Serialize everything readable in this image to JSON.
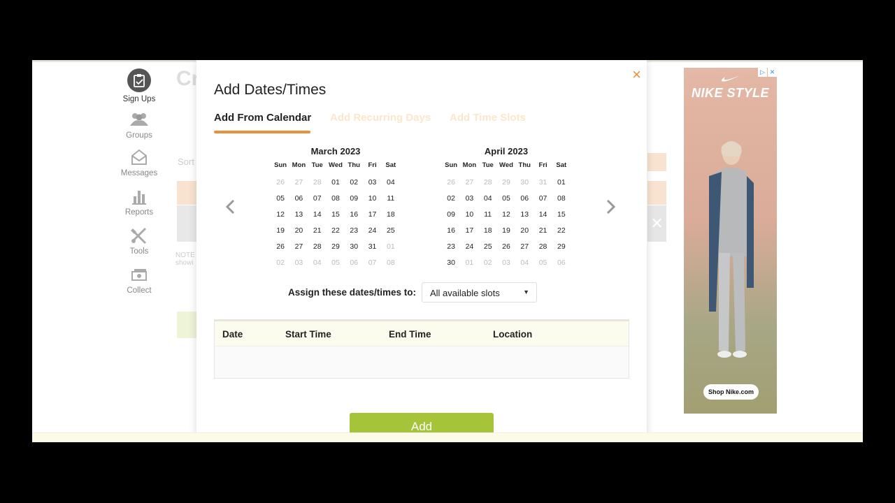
{
  "nav": {
    "items": [
      {
        "label": "Sign Ups",
        "icon": "clipboard-icon"
      },
      {
        "label": "Groups",
        "icon": "people-icon"
      },
      {
        "label": "Messages",
        "icon": "envelope-icon"
      },
      {
        "label": "Reports",
        "icon": "bar-chart-icon"
      },
      {
        "label": "Tools",
        "icon": "tools-icon"
      },
      {
        "label": "Collect",
        "icon": "money-icon"
      }
    ]
  },
  "background": {
    "title": "Cr",
    "sort_label": "Sort",
    "note": "NOTE",
    "note2": "showi"
  },
  "modal": {
    "title": "Add Dates/Times",
    "close": "×",
    "tabs": [
      {
        "label": "Add From Calendar",
        "active": true
      },
      {
        "label": "Add Recurring Days",
        "active": false
      },
      {
        "label": "Add Time Slots",
        "active": false
      }
    ],
    "prev": "‹",
    "next": "›",
    "weekdays": [
      "Sun",
      "Mon",
      "Tue",
      "Wed",
      "Thu",
      "Fri",
      "Sat"
    ],
    "calendars": [
      {
        "title": "March 2023",
        "weeks": [
          [
            [
              "26",
              1
            ],
            [
              "27",
              1
            ],
            [
              "28",
              1
            ],
            [
              "01",
              0
            ],
            [
              "02",
              0
            ],
            [
              "03",
              0
            ],
            [
              "04",
              0
            ]
          ],
          [
            [
              "05",
              0
            ],
            [
              "06",
              0
            ],
            [
              "07",
              0
            ],
            [
              "08",
              0
            ],
            [
              "09",
              0
            ],
            [
              "10",
              0
            ],
            [
              "11",
              0
            ]
          ],
          [
            [
              "12",
              0
            ],
            [
              "13",
              0
            ],
            [
              "14",
              0
            ],
            [
              "15",
              0
            ],
            [
              "16",
              0
            ],
            [
              "17",
              0
            ],
            [
              "18",
              0
            ]
          ],
          [
            [
              "19",
              0
            ],
            [
              "20",
              0
            ],
            [
              "21",
              0
            ],
            [
              "22",
              0
            ],
            [
              "23",
              0
            ],
            [
              "24",
              0
            ],
            [
              "25",
              0
            ]
          ],
          [
            [
              "26",
              0
            ],
            [
              "27",
              0
            ],
            [
              "28",
              0
            ],
            [
              "29",
              0
            ],
            [
              "30",
              0
            ],
            [
              "31",
              0
            ],
            [
              "01",
              1
            ]
          ],
          [
            [
              "02",
              1
            ],
            [
              "03",
              1
            ],
            [
              "04",
              1
            ],
            [
              "05",
              1
            ],
            [
              "06",
              1
            ],
            [
              "07",
              1
            ],
            [
              "08",
              1
            ]
          ]
        ]
      },
      {
        "title": "April 2023",
        "weeks": [
          [
            [
              "26",
              1
            ],
            [
              "27",
              1
            ],
            [
              "28",
              1
            ],
            [
              "29",
              1
            ],
            [
              "30",
              1
            ],
            [
              "31",
              1
            ],
            [
              "01",
              0
            ]
          ],
          [
            [
              "02",
              0
            ],
            [
              "03",
              0
            ],
            [
              "04",
              0
            ],
            [
              "05",
              0
            ],
            [
              "06",
              0
            ],
            [
              "07",
              0
            ],
            [
              "08",
              0
            ]
          ],
          [
            [
              "09",
              0
            ],
            [
              "10",
              0
            ],
            [
              "11",
              0
            ],
            [
              "12",
              0
            ],
            [
              "13",
              0
            ],
            [
              "14",
              0
            ],
            [
              "15",
              0
            ]
          ],
          [
            [
              "16",
              0
            ],
            [
              "17",
              0
            ],
            [
              "18",
              0
            ],
            [
              "19",
              0
            ],
            [
              "20",
              0
            ],
            [
              "21",
              0
            ],
            [
              "22",
              0
            ]
          ],
          [
            [
              "23",
              0
            ],
            [
              "24",
              0
            ],
            [
              "25",
              0
            ],
            [
              "26",
              0
            ],
            [
              "27",
              0
            ],
            [
              "28",
              0
            ],
            [
              "29",
              0
            ]
          ],
          [
            [
              "30",
              0
            ],
            [
              "01",
              1
            ],
            [
              "02",
              1
            ],
            [
              "03",
              1
            ],
            [
              "04",
              1
            ],
            [
              "05",
              1
            ],
            [
              "06",
              1
            ]
          ]
        ]
      }
    ],
    "assign_label": "Assign these dates/times to:",
    "assign_value": "All available slots",
    "table_headers": [
      "Date",
      "Start Time",
      "End Time",
      "Location"
    ],
    "add_button": "Add"
  },
  "ad": {
    "brand": "NIKE STYLE",
    "cta": "Shop Nike.com",
    "badge_icons": [
      "adchoices-icon",
      "close-icon"
    ]
  },
  "colors": {
    "accent_orange": "#e8903a",
    "add_green": "#a6c43a",
    "table_head_bg": "#fcfcee"
  }
}
